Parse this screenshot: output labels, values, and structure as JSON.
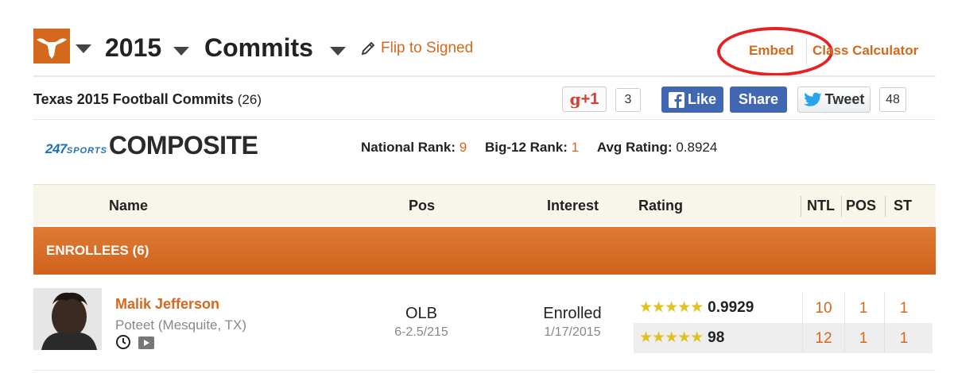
{
  "header": {
    "logo_icon": "longhorn-icon",
    "year": "2015",
    "type": "Commits",
    "flip_label": "Flip to Signed",
    "embed_label": "Embed",
    "calculator_label": "Class Calculator"
  },
  "title": {
    "text": "Texas 2015 Football Commits",
    "count": "(26)"
  },
  "social": {
    "gplus_label": "+1",
    "gplus_count": "3",
    "fb_like_label": "Like",
    "fb_share_label": "Share",
    "tweet_label": "Tweet",
    "tweet_count": "48"
  },
  "composite": {
    "logo_247": "247",
    "logo_sports": "SPORTS",
    "logo_composite": "COMPOSITE",
    "national_rank_label": "National Rank:",
    "national_rank": "9",
    "conf_rank_label": "Big-12 Rank:",
    "conf_rank": "1",
    "avg_rating_label": "Avg Rating:",
    "avg_rating": "0.8924"
  },
  "table": {
    "headers": {
      "name": "Name",
      "pos": "Pos",
      "interest": "Interest",
      "rating": "Rating",
      "ntl": "NTL",
      "pos_rank": "POS",
      "st": "ST"
    },
    "section": "ENROLLEES (6)",
    "rows": [
      {
        "name": "Malik Jefferson",
        "school": "Poteet (Mesquite, TX)",
        "position": "OLB",
        "measurements": "6-2.5/215",
        "status": "Enrolled",
        "date": "1/17/2015",
        "composite_stars": 5,
        "composite_rating": "0.9929",
        "composite_ntl": "10",
        "composite_pos": "1",
        "composite_st": "1",
        "sports_stars": 5,
        "sports_rating": "98",
        "sports_ntl": "12",
        "sports_pos": "1",
        "sports_st": "1"
      }
    ]
  },
  "colors": {
    "accent": "#d4681c",
    "facebook": "#4267b2",
    "highlight_ring": "#e52121",
    "star": "#e0c21c"
  }
}
